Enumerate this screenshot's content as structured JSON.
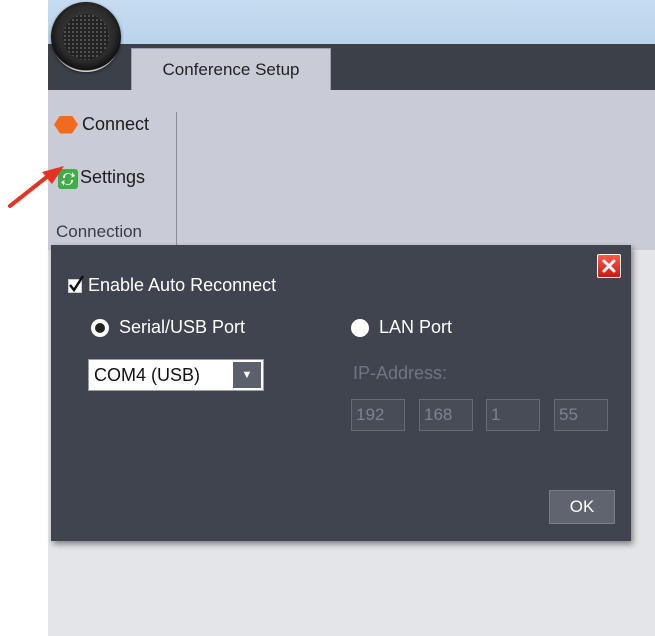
{
  "ribbon": {
    "tab_label": "Conference Setup",
    "connect_label": "Connect",
    "settings_label": "Settings",
    "group_label": "Connection"
  },
  "dialog": {
    "auto_reconnect_label": "Enable Auto Reconnect",
    "auto_reconnect_checked": true,
    "serial_label": "Serial/USB Port",
    "lan_label": "LAN Port",
    "serial_selected": true,
    "com_port_value": "COM4 (USB)",
    "ip_label": "IP-Address:",
    "ip_octets": [
      "192",
      "168",
      "1",
      "55"
    ],
    "ok_label": "OK"
  },
  "colors": {
    "dialog_bg": "#40444e",
    "ribbon_bg": "#c9ccd6",
    "tabstrip_bg": "#3c4049",
    "close_red": "#e0291d",
    "connect_orange": "#f26a1b",
    "settings_green": "#3fae49",
    "arrow_red": "#e53322"
  },
  "icons": {
    "connect": "hexagon-icon",
    "settings": "refresh-icon",
    "close": "close-icon",
    "dropdown": "chevron-down-icon"
  }
}
